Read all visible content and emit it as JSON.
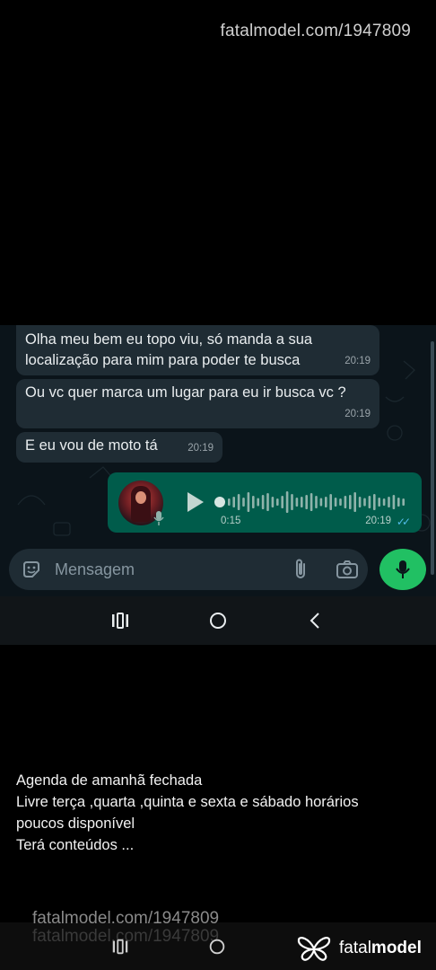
{
  "watermark_top": "fatalmodel.com/1947809",
  "messages": [
    {
      "text": "Olha meu bem eu topo viu, só manda a sua localização para mim para poder te busca",
      "time": "20:19"
    },
    {
      "text": "Ou vc quer marca um lugar para eu ir busca vc ?",
      "time": "20:19"
    },
    {
      "text": "E eu vou de moto tá",
      "time": "20:19"
    }
  ],
  "voice_note": {
    "duration": "0:15",
    "time": "20:19",
    "status_icon": "double-check-icon",
    "status_color": "#53bdeb"
  },
  "input": {
    "placeholder": "Mensagem"
  },
  "colors": {
    "chat_bg": "#0b141a",
    "incoming_bubble": "#1f2c34",
    "outgoing_bubble": "#005c4b",
    "accent_green": "#21c063"
  },
  "caption": [
    "Agenda de amanhã fechada",
    "Livre terça ,quarta ,quinta e sexta e sábado  horários",
    "poucos disponível",
    "Terá conteúdos ..."
  ],
  "watermark_bottom": "fatalmodel.com/1947809",
  "brand": {
    "light": "fatal",
    "bold": "model"
  }
}
